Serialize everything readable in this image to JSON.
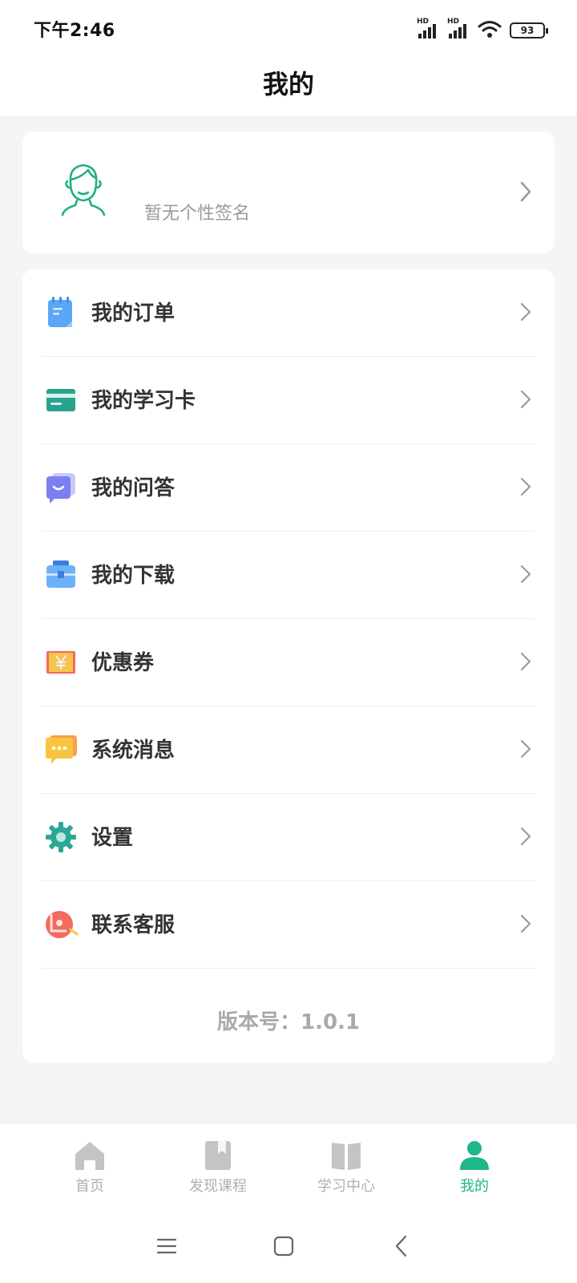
{
  "status_bar": {
    "time": "下午2:46",
    "signal_label": "HD",
    "battery": "93"
  },
  "header": {
    "title": "我的"
  },
  "profile": {
    "signature": "暂无个性签名",
    "avatar_icon": "user-avatar-outline-icon"
  },
  "menu": {
    "items": [
      {
        "label": "我的订单",
        "icon": "order-notepad-icon",
        "color": "#5aa7f6"
      },
      {
        "label": "我的学习卡",
        "icon": "study-card-icon",
        "color": "#2aa38e"
      },
      {
        "label": "我的问答",
        "icon": "qa-chat-icon",
        "color": "#7b7ff0"
      },
      {
        "label": "我的下载",
        "icon": "download-box-icon",
        "color": "#4b9bf0"
      },
      {
        "label": "优惠券",
        "icon": "coupon-icon",
        "color": "#f3b64a"
      },
      {
        "label": "系统消息",
        "icon": "message-bubble-icon",
        "color": "#f8c53f"
      },
      {
        "label": "设置",
        "icon": "settings-gear-icon",
        "color": "#2ba796"
      },
      {
        "label": "联系客服",
        "icon": "customer-service-icon",
        "color": "#f26b5b"
      }
    ],
    "version": "版本号：1.0.1"
  },
  "tabs": [
    {
      "label": "首页",
      "icon": "home-icon",
      "active": false
    },
    {
      "label": "发现课程",
      "icon": "bookmark-book-icon",
      "active": false
    },
    {
      "label": "学习中心",
      "icon": "open-book-icon",
      "active": false
    },
    {
      "label": "我的",
      "icon": "person-icon",
      "active": true
    }
  ],
  "colors": {
    "accent": "#1fb68b",
    "inactive_tab": "#b0b0b0",
    "page_bg": "#f4f5f7"
  },
  "system_nav": {
    "buttons": [
      "menu-icon",
      "home-square-icon",
      "back-icon"
    ]
  }
}
